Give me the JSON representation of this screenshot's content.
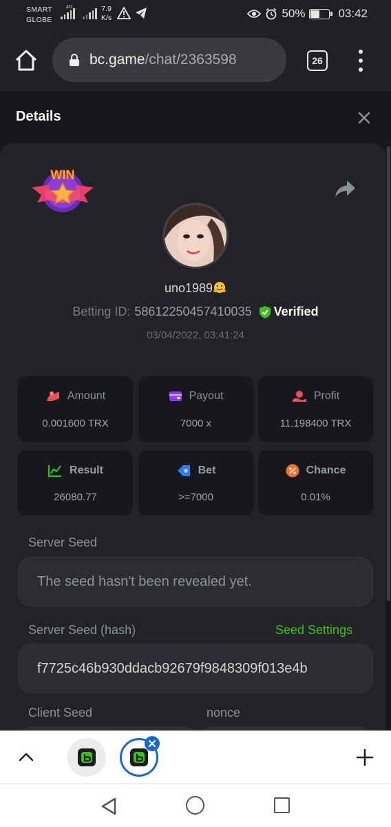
{
  "status_bar": {
    "carrier_line1": "SMART",
    "carrier_line2": "GLOBE",
    "network_type": "4G",
    "speed_value": "7.9",
    "speed_unit": "K/s",
    "battery": "50%",
    "battery_level": 0.5,
    "time": "03:42"
  },
  "browser": {
    "url_host": "bc.game",
    "url_path": "/chat/2363598",
    "tab_count": "26"
  },
  "details": {
    "title": "Details",
    "badge": "WIN",
    "username": "uno1989",
    "betting_id_label": "Betting ID:",
    "betting_id": "58612250457410035",
    "verified": "Verified",
    "timestamp": "03/04/2022, 03:41:24",
    "stats": [
      {
        "label": "Amount",
        "value": "0.001600 TRX",
        "icon": "amount-icon",
        "color": "#e8505b"
      },
      {
        "label": "Payout",
        "value": "7000 x",
        "icon": "wallet-icon",
        "color": "#8c3df2"
      },
      {
        "label": "Profit",
        "value": "11.198400 TRX",
        "icon": "profit-icon",
        "color": "#e8505b"
      },
      {
        "label": "Result",
        "value": "26080.77",
        "icon": "result-icon",
        "color": "#3bc117"
      },
      {
        "label": "Bet",
        "value": ">=7000",
        "icon": "bet-icon",
        "color": "#2f7bf2"
      },
      {
        "label": "Chance",
        "value": "0.01%",
        "icon": "percent-icon",
        "color": "#f0722a"
      }
    ],
    "server_seed_label": "Server Seed",
    "server_seed_value": "The seed hasn't been revealed yet.",
    "server_seed_hash_label": "Server Seed (hash)",
    "seed_settings_link": "Seed Settings",
    "server_seed_hash_value": "f7725c46b930ddacb92679f9848309f013e4b",
    "client_seed_label": "Client Seed",
    "nonce_label": "nonce"
  },
  "colors": {
    "accent_green": "#3bc117",
    "background": "#17181b",
    "card": "#222326",
    "tab_active": "#1a66d2"
  }
}
